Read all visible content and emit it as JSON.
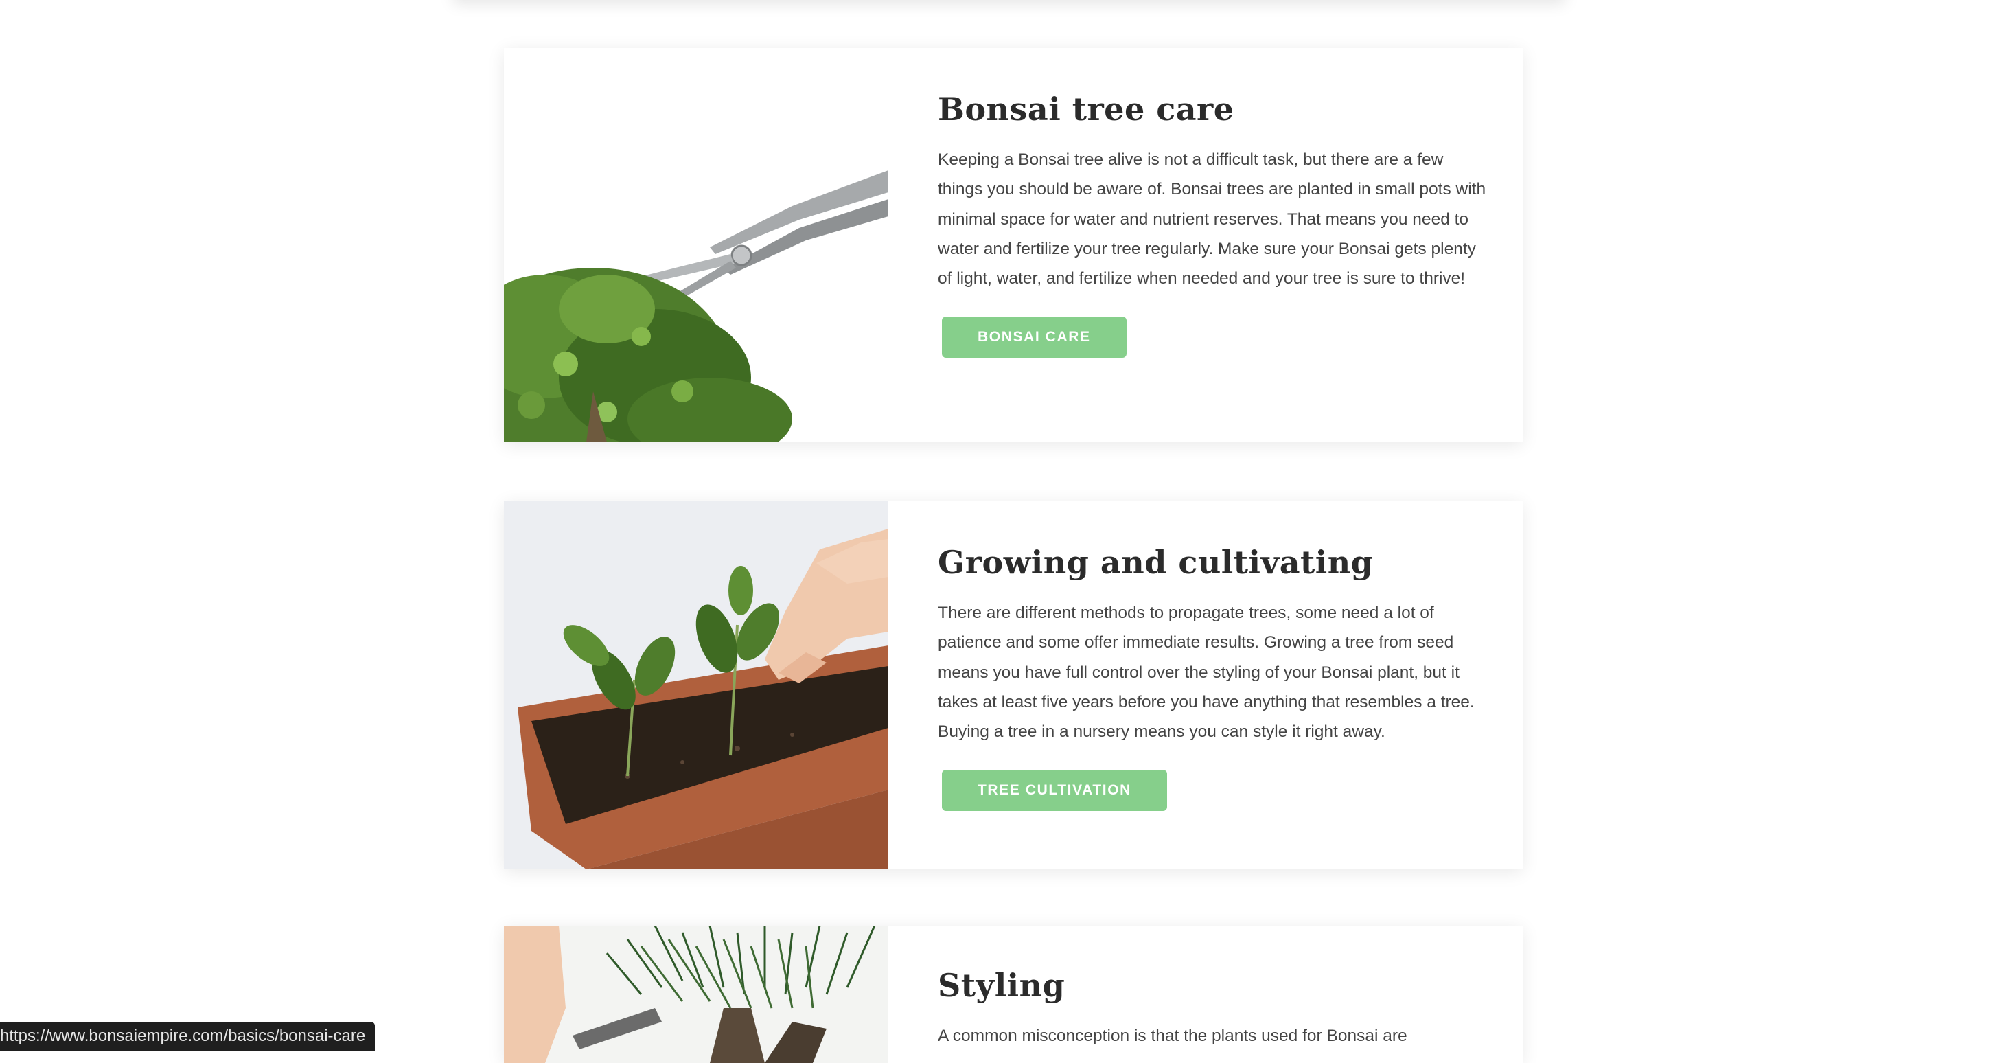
{
  "cards": [
    {
      "title": "Bonsai tree care",
      "text": "Keeping a Bonsai tree alive is not a difficult task, but there are a few things you should be aware of. Bonsai trees are planted in small pots with minimal space for water and nutrient reserves. That means you need to water and fertilize your tree regularly. Make sure your Bonsai gets plenty of light, water, and fertilize when needed and your tree is sure to thrive!",
      "button": "BONSAI CARE"
    },
    {
      "title": "Growing and cultivating",
      "text": "There are different methods to propagate trees, some need a lot of patience and some offer immediate results. Growing a tree from seed means you have full control over the styling of your Bonsai plant, but it takes at least five years before you have anything that resembles a tree. Buying a tree in a nursery means you can style it right away.",
      "button": "TREE CULTIVATION"
    },
    {
      "title": "Styling",
      "text": "A common misconception is that the plants used for Bonsai are"
    }
  ],
  "status_bar": {
    "url": "https://www.bonsaiempire.com/basics/bonsai-care"
  },
  "colors": {
    "button": "#86cf8b",
    "title": "#2b2b2b",
    "body_text": "#444444",
    "status_bar": "#1f1f1f"
  },
  "icons": [
    "bonsai-pruning-photo",
    "seedling-pot-photo",
    "pine-styling-photo"
  ]
}
